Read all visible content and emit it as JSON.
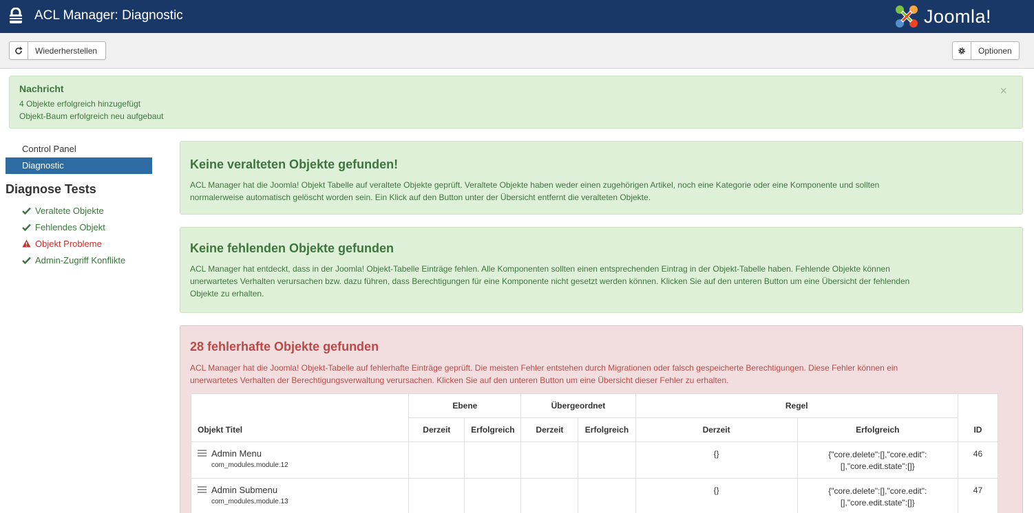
{
  "header": {
    "title": "ACL Manager: Diagnostic",
    "logo_text": "Joomla!",
    "colors": {
      "bar": "#1a3867"
    }
  },
  "toolbar": {
    "restore_label": "Wiederherstellen",
    "restore_icon": "refresh-icon",
    "options_label": "Optionen",
    "options_icon": "gear-icon"
  },
  "alert": {
    "heading": "Nachricht",
    "lines": [
      "4 Objekte erfolgreich hinzugefügt",
      "Objekt-Baum erfolgreich neu aufgebaut"
    ],
    "close": "×"
  },
  "sidebar": {
    "items": [
      {
        "label": "Control Panel",
        "active": false
      },
      {
        "label": "Diagnostic",
        "active": true
      }
    ],
    "heading": "Diagnose Tests",
    "tests": [
      {
        "label": "Veraltete Objekte",
        "status": "ok"
      },
      {
        "label": "Fehlendes Objekt",
        "status": "ok"
      },
      {
        "label": "Objekt Probleme",
        "status": "error"
      },
      {
        "label": "Admin-Zugriff Konflikte",
        "status": "ok"
      }
    ]
  },
  "panels": [
    {
      "title": "Keine veralteten Objekte gefunden!",
      "lines": [
        "ACL Manager hat die Joomla! Objekt Tabelle auf veraltete Objekte geprüft. Veraltete Objekte haben weder einen zugehörigen Artikel, noch eine Kategorie oder eine Komponente und sollten",
        "normalerweise automatisch gelöscht worden sein. Ein Klick auf den Button unter der Übersicht entfernt die veralteten Objekte."
      ]
    },
    {
      "title": "Keine fehlenden Objekte gefunden",
      "lines": [
        "ACL Manager hat entdeckt, dass in der Joomla! Objekt-Tabelle Einträge fehlen. Alle Komponenten sollten einen entsprechenden Eintrag in der Objekt-Tabelle haben. Fehlende Objekte können",
        "unerwartetes Verhalten verursachen bzw. dazu führen, dass Berechtigungen für eine Komponente nicht gesetzt werden können. Klicken Sie auf den unteren Button um eine Übersicht der fehlenden",
        "Objekte zu erhalten."
      ]
    },
    {
      "title": "28 fehlerhafte Objekte gefunden",
      "lines": [
        "ACL Manager hat die Joomla! Objekt-Tabelle auf fehlerhafte Einträge geprüft. Die meisten Fehler entstehen durch Migrationen oder falsch gespeicherte Berechtigungen. Diese Fehler können ein",
        "unerwartetes Verhalten der Berechtigungsverwaltung verursachen. Klicken Sie auf den unteren Button um eine Übersicht dieser Fehler zu erhalten."
      ]
    }
  ],
  "table": {
    "group_headers": {
      "level": "Ebene",
      "parent": "Übergeordnet",
      "rule": "Regel"
    },
    "headers": {
      "title": "Objekt Titel",
      "level_current": "Derzeit",
      "level_success": "Erfolgreich",
      "parent_current": "Derzeit",
      "parent_success": "Erfolgreich",
      "rule_current": "Derzeit",
      "rule_success": "Erfolgreich",
      "id": "ID"
    },
    "rows": [
      {
        "title": "Admin Menu",
        "name": "com_modules.module.12",
        "level_current": "",
        "level_success": "",
        "parent_current": "",
        "parent_success": "",
        "rule_current": "{}",
        "rule_success_1": "{\"core.delete\":[],\"core.edit\":",
        "rule_success_2": "[],\"core.edit.state\":[]}",
        "id": "46"
      },
      {
        "title": "Admin Submenu",
        "name": "com_modules.module.13",
        "level_current": "",
        "level_success": "",
        "parent_current": "",
        "parent_success": "",
        "rule_current": "{}",
        "rule_success_1": "{\"core.delete\":[],\"core.edit\":",
        "rule_success_2": "[],\"core.edit.state\":[]}",
        "id": "47"
      }
    ]
  }
}
